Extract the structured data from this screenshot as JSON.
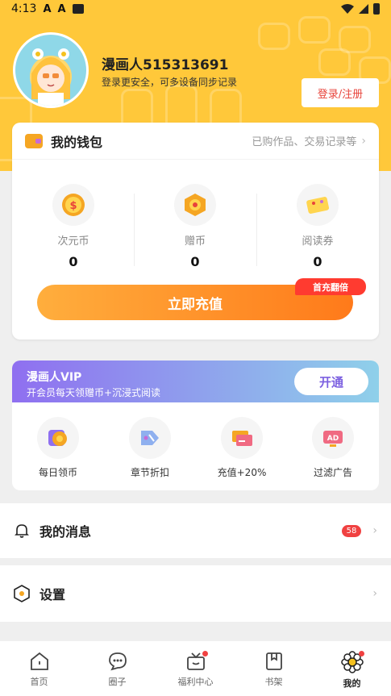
{
  "status_bar": {
    "time": "4:13"
  },
  "profile": {
    "username": "漫画人515313691",
    "subtitle": "登录更安全，可多设备同步记录",
    "login_label": "登录/注册"
  },
  "wallet": {
    "title": "我的钱包",
    "link": "已购作品、交易记录等",
    "items": [
      {
        "label": "次元币",
        "value": "0"
      },
      {
        "label": "赠币",
        "value": "0"
      },
      {
        "label": "阅读券",
        "value": "0"
      }
    ],
    "recharge_label": "立即充值",
    "first_badge": "首充翻倍"
  },
  "vip": {
    "title": "漫画人VIP",
    "subtitle": "开会员每天领赠币+沉浸式阅读",
    "button": "开通",
    "features": [
      {
        "label": "每日领币"
      },
      {
        "label": "章节折扣"
      },
      {
        "label": "充值+20%"
      },
      {
        "label": "过滤广告"
      }
    ]
  },
  "menu": {
    "messages_label": "我的消息",
    "messages_count": "58",
    "settings_label": "设置"
  },
  "nav": [
    {
      "label": "首页"
    },
    {
      "label": "圈子"
    },
    {
      "label": "福利中心"
    },
    {
      "label": "书架"
    },
    {
      "label": "我的"
    }
  ],
  "colors": {
    "brand_yellow": "#ffc83a",
    "accent_orange": "#ff7a1a",
    "badge_red": "#f04141",
    "vip_purple": "#8f6ff0"
  }
}
